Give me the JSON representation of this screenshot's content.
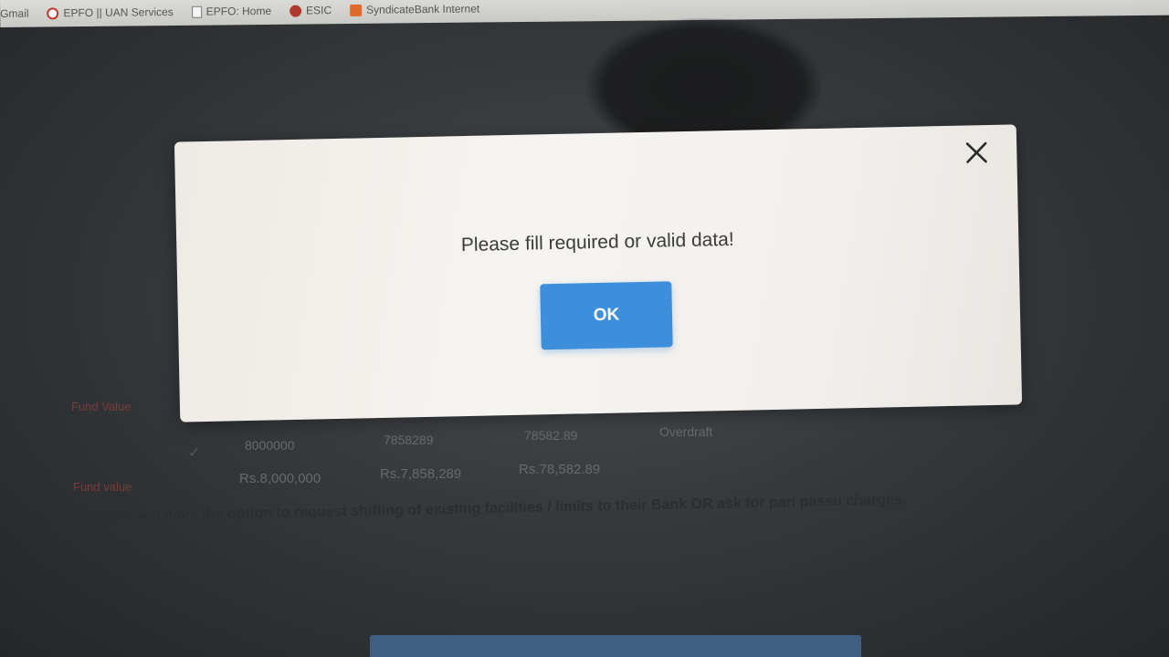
{
  "bookmarks": [
    {
      "label": "Gmail",
      "icon": "gmail-icon"
    },
    {
      "label": "EPFO || UAN Services",
      "icon": "epfo-icon"
    },
    {
      "label": "EPFO: Home",
      "icon": "page-icon"
    },
    {
      "label": "ESIC",
      "icon": "esic-icon"
    },
    {
      "label": "SyndicateBank Internet",
      "icon": "syndicate-icon"
    }
  ],
  "modal": {
    "message": "Please fill required or valid data!",
    "ok_label": "OK",
    "close_icon": "close-icon"
  },
  "background": {
    "row1": [
      "8000000",
      "7858289",
      "78582.89",
      "Overdraft"
    ],
    "row2": [
      "Rs.8,000,000",
      "Rs.7,858,289",
      "Rs.78,582.89"
    ],
    "label1": "Fund Value",
    "label2": "Fund value",
    "note": "Note : The Banker will have the option to request shifting of existing facilities / limits to their Bank OR ask for pari passu charges."
  },
  "colors": {
    "accent": "#3d8fdc",
    "modal_bg": "#f4f2ef",
    "message_text": "#3b3b3b"
  }
}
